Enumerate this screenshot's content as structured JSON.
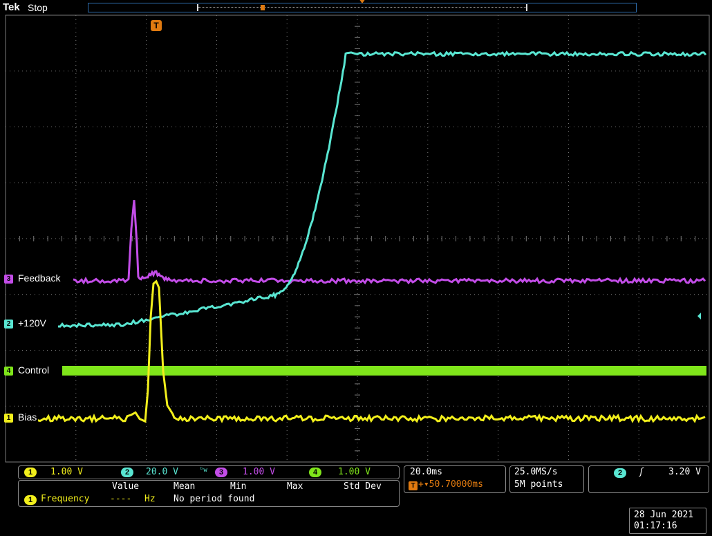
{
  "header": {
    "brand": "Tek",
    "run_state": "Stop",
    "trigger_marker_label": "T",
    "record_marker_label": "T"
  },
  "colors": {
    "ch1": "#f2ef1c",
    "ch2": "#59e6d2",
    "ch3": "#c34de8",
    "ch4": "#7fe51a",
    "trigger": "#e07a10",
    "grid": "#7a7a7a"
  },
  "channels": [
    {
      "id": "3",
      "label": "Feedback",
      "color": "#c34de8"
    },
    {
      "id": "2",
      "label": "+120V",
      "color": "#59e6d2"
    },
    {
      "id": "4",
      "label": "Control",
      "color": "#7fe51a"
    },
    {
      "id": "1",
      "label": "Bias",
      "color": "#f2ef1c"
    }
  ],
  "scales": [
    {
      "ch": "1",
      "value": "1.00 V",
      "color": "#f2ef1c"
    },
    {
      "ch": "2",
      "value": "20.0 V",
      "suffix": "ᵇw",
      "color": "#59e6d2"
    },
    {
      "ch": "3",
      "value": "1.00 V",
      "color": "#c34de8"
    },
    {
      "ch": "4",
      "value": "1.00 V",
      "color": "#7fe51a"
    }
  ],
  "measurements": {
    "headers": [
      "Value",
      "Mean",
      "Min",
      "Max",
      "Std Dev"
    ],
    "row": {
      "ch": "1",
      "name": "Frequency",
      "value": "----",
      "unit": "Hz",
      "status": "No period found"
    }
  },
  "timebase": {
    "scale": "20.0ms",
    "trigger_position": "+▾50.70000ms"
  },
  "acquisition": {
    "sample_rate": "25.0MS/s",
    "record_length": "5M points"
  },
  "trigger": {
    "source": "2",
    "slope_icon": "rising-edge",
    "slope_glyph": "ʃ",
    "level": "3.20 V"
  },
  "datetime": {
    "date": "28 Jun 2021",
    "time": "01:17:16"
  }
}
